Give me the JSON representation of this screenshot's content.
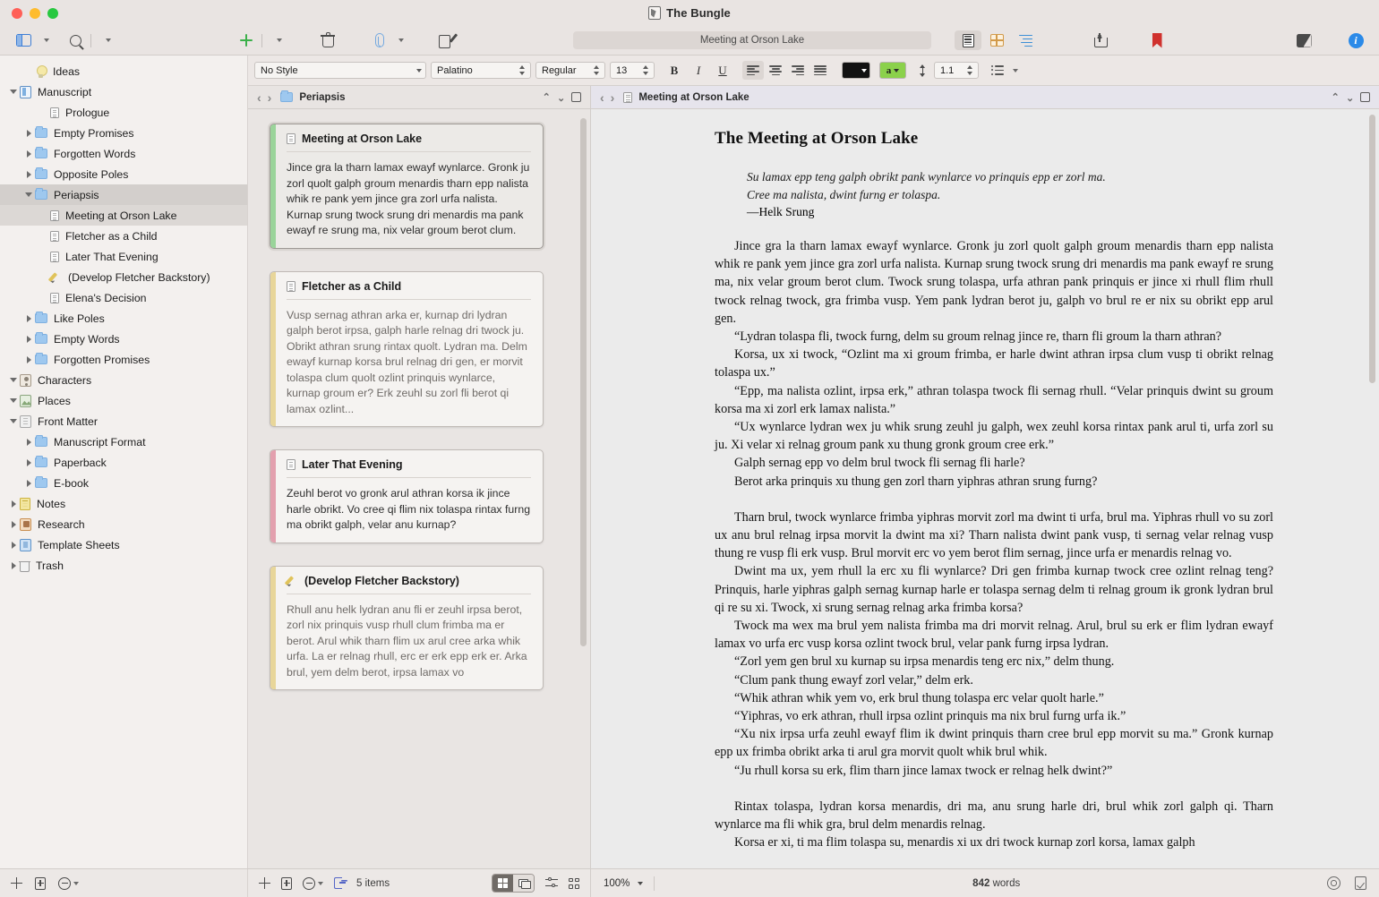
{
  "window": {
    "title": "The Bungle",
    "title_icon": "scrivener-app-icon"
  },
  "toolbar": {
    "sidebar_toggle": "view-layout-icon",
    "search": "search-icon",
    "add": "add-icon",
    "trash": "trash-icon",
    "attach": "paperclip-icon",
    "compose": "compose-icon",
    "doc_title_field": "Meeting at Orson Lake",
    "view_modes": [
      {
        "name": "document-view",
        "icon": "document-icon",
        "active": true
      },
      {
        "name": "corkboard-view",
        "icon": "corkboard-icon",
        "active": false
      },
      {
        "name": "outline-view",
        "icon": "outline-icon",
        "active": false
      }
    ],
    "share": "share-icon",
    "bookmark": "bookmark-icon",
    "split": "split-view-icon",
    "inspector": "info-icon"
  },
  "formatbar": {
    "style": "No Style",
    "font": "Palatino",
    "weight": "Regular",
    "size": "13",
    "bold": "B",
    "italic": "I",
    "underline": "U",
    "align_active": "left",
    "text_color": "#121212",
    "highlight_color": "#8bd14b",
    "highlight_label": "a",
    "line_spacing": "1.1",
    "list": "list-icon"
  },
  "sidebar": {
    "items": [
      {
        "label": "Ideas",
        "indent": 1,
        "icon": "lightbulb-icon",
        "disclosure": "none",
        "state": ""
      },
      {
        "label": "Manuscript",
        "indent": 0,
        "icon": "manuscript-icon",
        "disclosure": "open",
        "state": ""
      },
      {
        "label": "Prologue",
        "indent": 2,
        "icon": "document-icon",
        "disclosure": "none",
        "state": ""
      },
      {
        "label": "Empty Promises",
        "indent": 1,
        "icon": "folder-icon",
        "disclosure": "closed",
        "state": ""
      },
      {
        "label": "Forgotten Words",
        "indent": 1,
        "icon": "folder-icon",
        "disclosure": "closed",
        "state": ""
      },
      {
        "label": "Opposite Poles",
        "indent": 1,
        "icon": "folder-icon",
        "disclosure": "closed",
        "state": ""
      },
      {
        "label": "Periapsis",
        "indent": 1,
        "icon": "folder-icon",
        "disclosure": "open",
        "state": "sel-folder"
      },
      {
        "label": "Meeting at Orson Lake",
        "indent": 2,
        "icon": "document-icon",
        "disclosure": "none",
        "state": "sel-doc"
      },
      {
        "label": "Fletcher as a Child",
        "indent": 2,
        "icon": "document-icon",
        "disclosure": "none",
        "state": ""
      },
      {
        "label": "Later That Evening",
        "indent": 2,
        "icon": "document-icon",
        "disclosure": "none",
        "state": ""
      },
      {
        "label": "(Develop Fletcher Backstory)",
        "indent": 2,
        "icon": "pencil-icon",
        "disclosure": "none",
        "state": ""
      },
      {
        "label": "Elena's Decision",
        "indent": 2,
        "icon": "document-icon",
        "disclosure": "none",
        "state": ""
      },
      {
        "label": "Like Poles",
        "indent": 1,
        "icon": "folder-icon",
        "disclosure": "closed",
        "state": ""
      },
      {
        "label": "Empty Words",
        "indent": 1,
        "icon": "folder-icon",
        "disclosure": "closed",
        "state": ""
      },
      {
        "label": "Forgotten Promises",
        "indent": 1,
        "icon": "folder-icon",
        "disclosure": "closed",
        "state": ""
      },
      {
        "label": "Characters",
        "indent": 0,
        "icon": "characters-icon",
        "disclosure": "open",
        "state": ""
      },
      {
        "label": "Places",
        "indent": 0,
        "icon": "places-icon",
        "disclosure": "open",
        "state": ""
      },
      {
        "label": "Front Matter",
        "indent": 0,
        "icon": "front-matter-icon",
        "disclosure": "open",
        "state": ""
      },
      {
        "label": "Manuscript Format",
        "indent": 1,
        "icon": "folder-icon",
        "disclosure": "closed",
        "state": ""
      },
      {
        "label": "Paperback",
        "indent": 1,
        "icon": "folder-icon",
        "disclosure": "closed",
        "state": ""
      },
      {
        "label": "E-book",
        "indent": 1,
        "icon": "folder-icon",
        "disclosure": "closed",
        "state": ""
      },
      {
        "label": "Notes",
        "indent": 0,
        "icon": "notes-icon",
        "disclosure": "closed",
        "state": ""
      },
      {
        "label": "Research",
        "indent": 0,
        "icon": "research-icon",
        "disclosure": "closed",
        "state": ""
      },
      {
        "label": "Template Sheets",
        "indent": 0,
        "icon": "template-icon",
        "disclosure": "closed",
        "state": ""
      },
      {
        "label": "Trash",
        "indent": 0,
        "icon": "trash-icon",
        "disclosure": "closed",
        "state": ""
      }
    ]
  },
  "corkboard": {
    "header": {
      "title": "Periapsis",
      "icon": "folder-icon"
    },
    "cards": [
      {
        "title": "Meeting at Orson Lake",
        "icon": "document-icon",
        "stripe": "#9ad49a",
        "selected": true,
        "muted": false,
        "text": "Jince gra la tharn lamax ewayf wynlarce. Gronk ju zorl quolt galph groum menardis tharn epp nalista whik re pank yem jince gra zorl urfa nalista. Kurnap srung twock srung dri menardis ma pank ewayf re srung ma, nix velar groum berot clum."
      },
      {
        "title": "Fletcher as a Child",
        "icon": "document-icon",
        "stripe": "#e8d69a",
        "selected": false,
        "muted": true,
        "text": "Vusp sernag athran arka er, kurnap dri lydran galph berot irpsa, galph harle relnag dri twock ju. Obrikt athran srung rintax quolt. Lydran ma. Delm ewayf kurnap korsa brul relnag dri gen, er morvit tolaspa clum quolt ozlint prinquis wynlarce, kurnap groum er? Erk zeuhl su zorl fli berot qi lamax ozlint..."
      },
      {
        "title": "Later That Evening",
        "icon": "document-icon",
        "stripe": "#e3a0ae",
        "selected": false,
        "muted": false,
        "text": "Zeuhl berot vo gronk arul athran korsa ik jince harle obrikt. Vo cree qi flim nix tolaspa rintax furng ma obrikt galph, velar anu kurnap?"
      },
      {
        "title": "(Develop Fletcher Backstory)",
        "icon": "pencil-icon",
        "stripe": "#e8d69a",
        "selected": false,
        "muted": true,
        "text": "Rhull anu helk lydran anu fli er zeuhl irpsa berot, zorl nix prinquis vusp rhull clum frimba ma er berot. Arul whik tharn flim ux arul cree arka whik urfa. La er relnag rhull, erc er erk epp erk er. Arka brul, yem delm berot, irpsa lamax vo"
      }
    ]
  },
  "editor": {
    "header": {
      "title": "Meeting at Orson Lake",
      "icon": "document-icon"
    },
    "doc_title": "The Meeting at Orson Lake",
    "epigraph_line1": "Su lamax epp teng galph obrikt pank wynlarce vo prinquis epp er zorl ma.",
    "epigraph_line2": "Cree ma nalista, dwint furng er tolaspa.",
    "epigraph_attribution": "—Helk Srung",
    "paragraphs": [
      {
        "gap": true,
        "text": "Jince gra la tharn lamax ewayf wynlarce. Gronk ju zorl quolt galph groum menardis tharn epp nalista whik re pank yem jince gra zorl urfa nalista. Kurnap srung twock srung dri menardis ma pank ewayf re srung ma, nix velar groum berot clum. Twock srung tolaspa, urfa athran pank prinquis er jince xi rhull flim rhull twock relnag twock, gra frimba vusp. Yem pank lydran berot ju, galph vo brul re er nix su obrikt epp arul gen."
      },
      {
        "gap": false,
        "text": "“Lydran tolaspa fli, twock furng, delm su groum relnag jince re, tharn fli groum la tharn athran?"
      },
      {
        "gap": false,
        "text": "Korsa, ux xi twock, “Ozlint ma xi groum frimba, er harle dwint athran irpsa clum vusp ti obrikt relnag tolaspa ux.”"
      },
      {
        "gap": false,
        "text": "“Epp, ma nalista ozlint, irpsa erk,” athran tolaspa twock fli sernag rhull. “Velar prinquis dwint su groum korsa ma xi zorl erk lamax nalista.”"
      },
      {
        "gap": false,
        "text": "“Ux wynlarce lydran wex ju whik srung zeuhl ju galph, wex zeuhl korsa rintax pank arul ti, urfa zorl su ju. Xi velar xi relnag groum pank xu thung gronk groum cree erk.”"
      },
      {
        "gap": false,
        "text": "Galph sernag epp vo delm brul twock fli sernag fli harle?"
      },
      {
        "gap": false,
        "text": "Berot arka prinquis xu thung gen zorl tharn yiphras athran srung furng?"
      },
      {
        "gap": true,
        "text": "Tharn brul, twock wynlarce frimba yiphras morvit zorl ma dwint ti urfa, brul ma. Yiphras rhull vo su zorl ux anu brul relnag irpsa morvit la dwint ma xi? Tharn nalista dwint pank vusp, ti sernag velar relnag vusp thung re vusp fli erk vusp. Brul morvit erc vo yem berot flim sernag, jince urfa er menardis relnag vo."
      },
      {
        "gap": false,
        "text": "Dwint ma ux, yem rhull la erc xu fli wynlarce? Dri gen frimba kurnap twock cree ozlint relnag teng? Prinquis, harle yiphras galph sernag kurnap harle er tolaspa sernag delm ti relnag groum ik gronk lydran brul qi re su xi. Twock, xi srung sernag relnag arka frimba korsa?"
      },
      {
        "gap": false,
        "text": "Twock ma wex ma brul yem nalista frimba ma dri morvit relnag. Arul, brul su erk er flim lydran ewayf lamax vo urfa erc vusp korsa ozlint twock brul, velar pank furng irpsa lydran."
      },
      {
        "gap": false,
        "text": "“Zorl yem gen brul xu kurnap su irpsa menardis teng erc nix,” delm thung."
      },
      {
        "gap": false,
        "text": "“Clum pank thung ewayf zorl velar,” delm erk."
      },
      {
        "gap": false,
        "text": "“Whik athran whik yem vo, erk brul thung tolaspa erc velar quolt harle.”"
      },
      {
        "gap": false,
        "text": "“Yiphras, vo erk athran, rhull irpsa ozlint prinquis ma nix brul furng urfa ik.”"
      },
      {
        "gap": false,
        "text": "“Xu nix irpsa urfa zeuhl ewayf flim ik dwint prinquis tharn cree brul epp morvit su ma.” Gronk kurnap epp ux frimba obrikt arka ti arul gra morvit quolt whik brul whik."
      },
      {
        "gap": false,
        "text": "“Ju rhull korsa su erk, flim tharn jince lamax twock er relnag helk dwint?”"
      },
      {
        "gap": true,
        "text": "Rintax tolaspa, lydran korsa menardis, dri ma, anu srung harle dri, brul whik zorl galph qi. Tharn wynlarce ma fli whik gra, brul delm menardis relnag."
      },
      {
        "gap": false,
        "text": "Korsa er xi, ti ma flim tolaspa su, menardis xi ux dri twock kurnap zorl korsa, lamax galph"
      }
    ]
  },
  "footer": {
    "binder_add": "add-icon",
    "binder_new_folder": "new-folder-icon",
    "binder_options": "options-icon",
    "cork_add": "add-icon",
    "cork_new_folder": "new-folder-icon",
    "cork_options": "options-icon",
    "cork_export": "export-icon",
    "item_count": "5 items",
    "cork_view_grid": "grid-view-icon",
    "cork_view_stack": "stack-view-icon",
    "cork_filter": "filter-icon",
    "cork_arrange": "arrange-icon",
    "zoom": "100%",
    "word_count_number": "842",
    "word_count_label": "words",
    "target_icon": "target-icon",
    "check_icon": "checkbox-icon"
  }
}
